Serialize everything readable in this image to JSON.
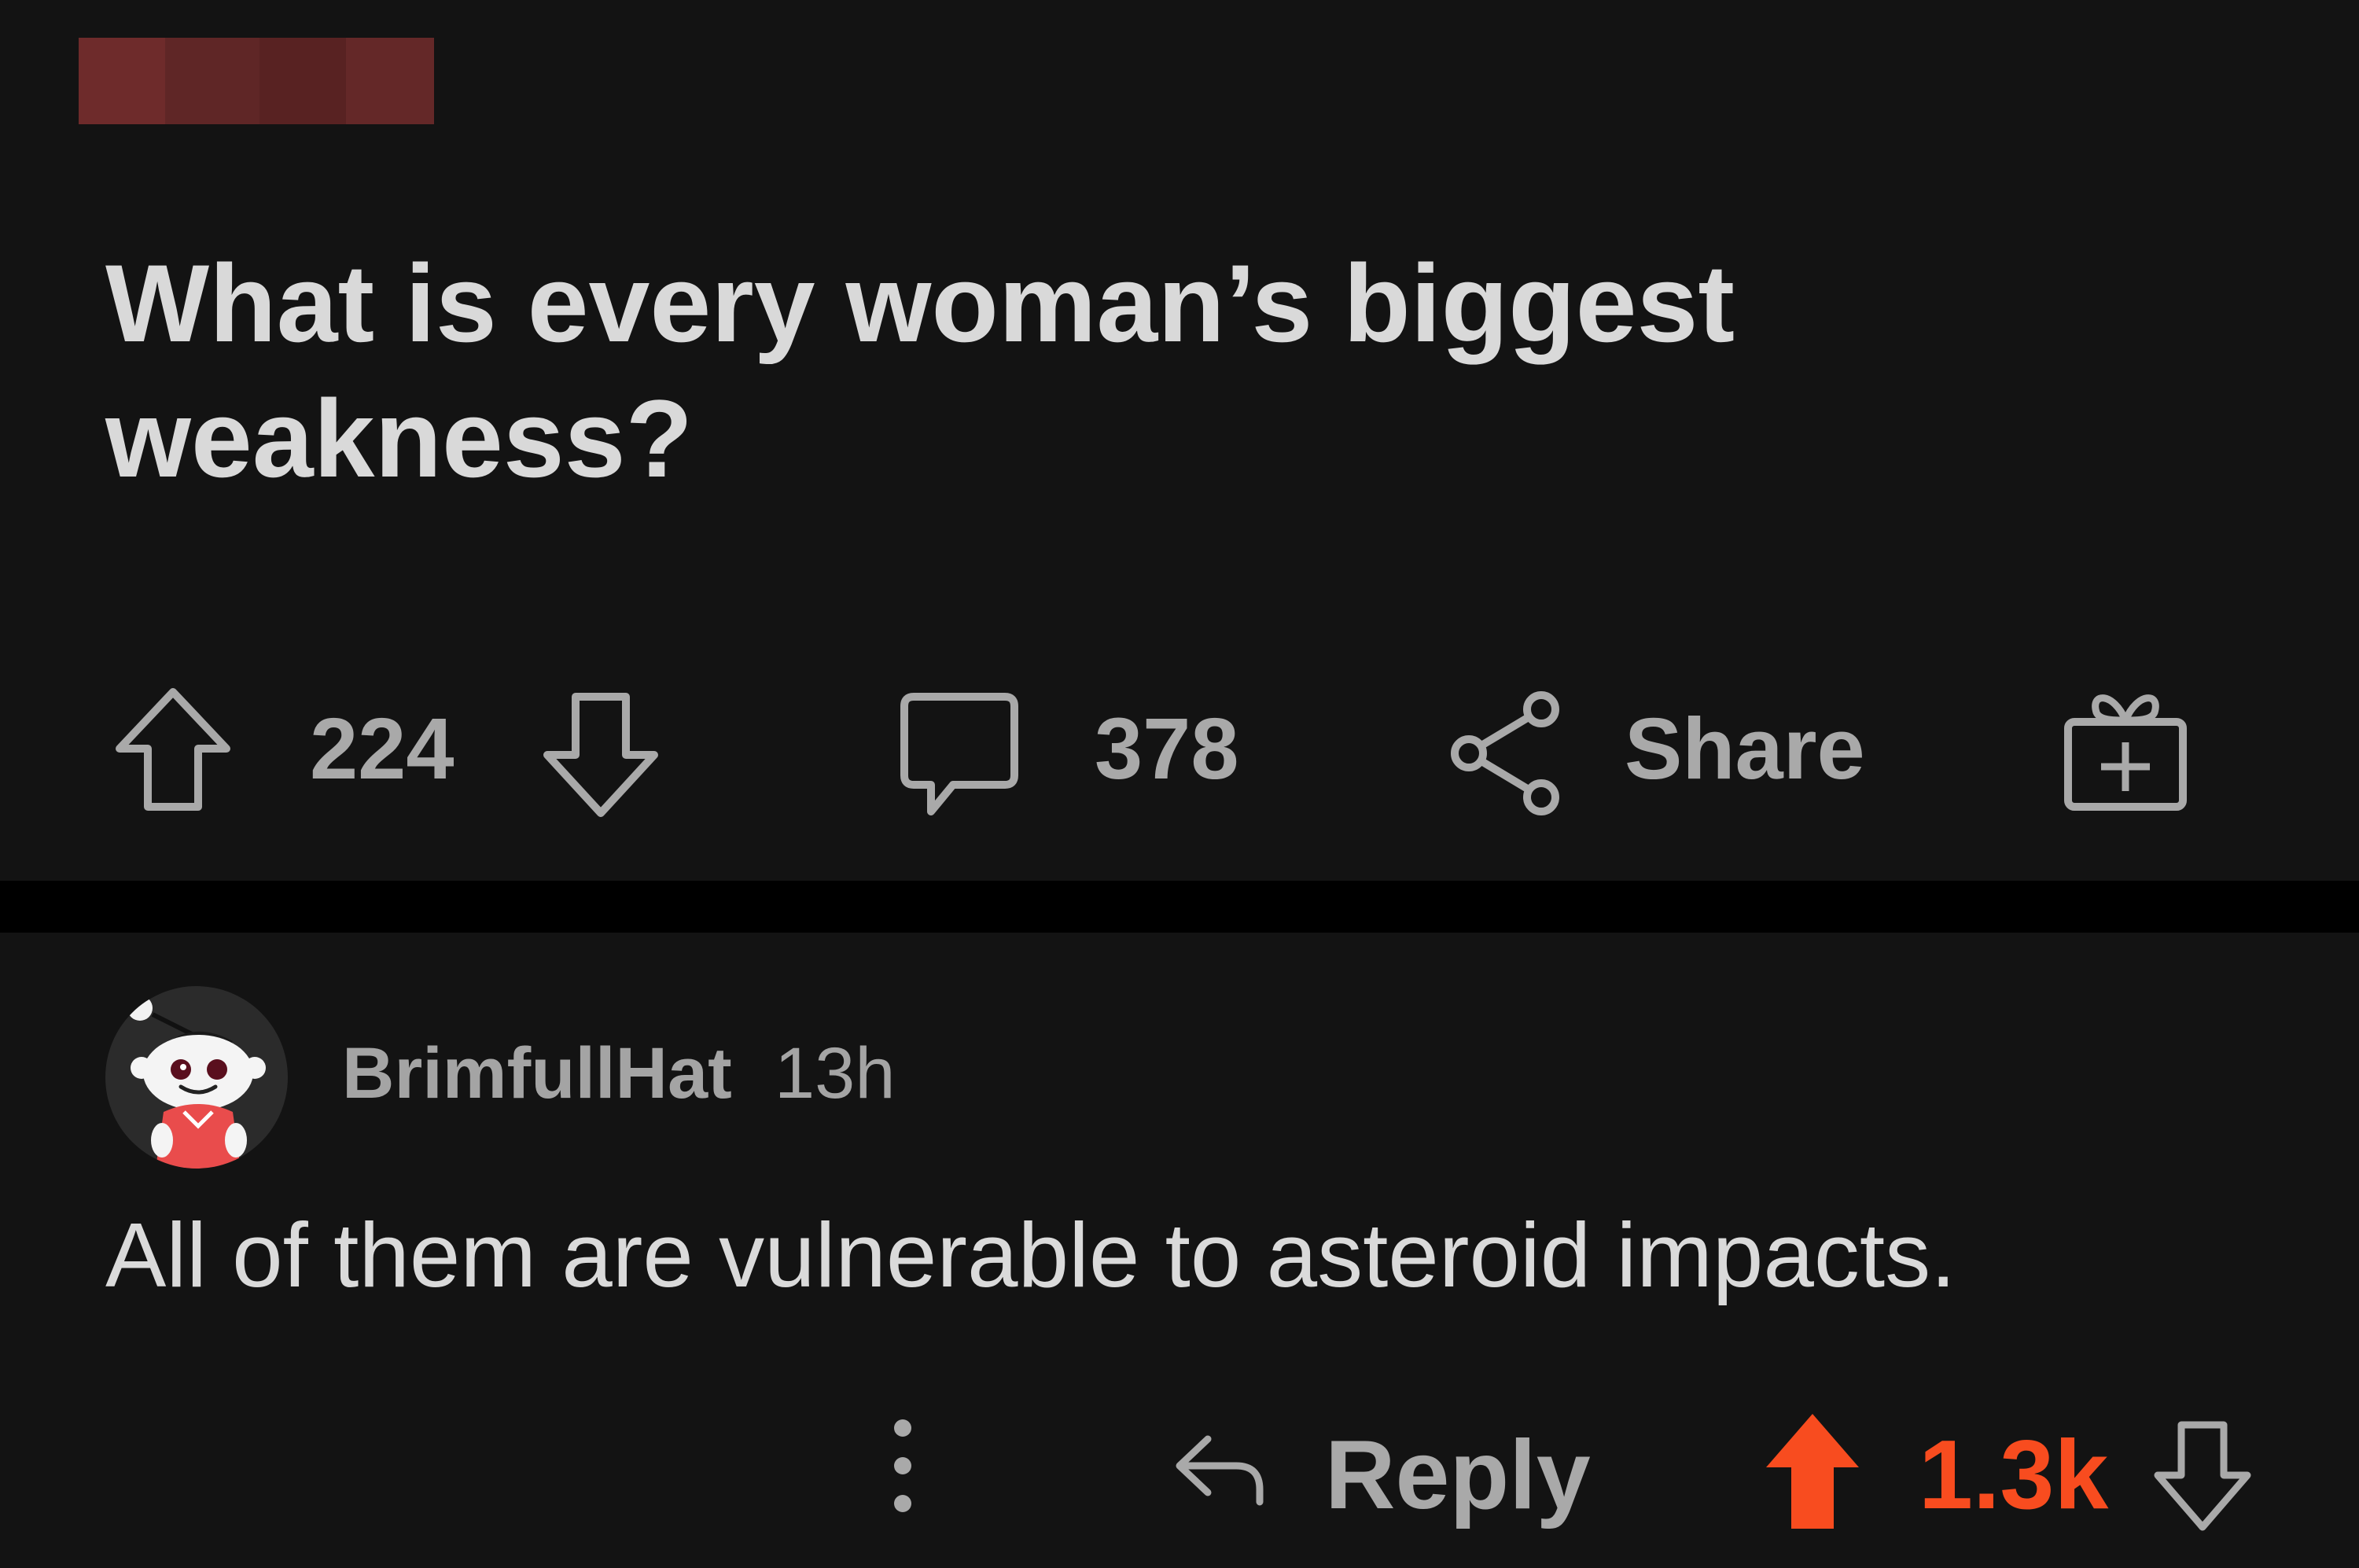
{
  "post": {
    "title": "What is every woman’s biggest weakness?",
    "upvotes": "224",
    "comments": "378",
    "share_label": "Share"
  },
  "comment": {
    "username": "BrimfullHat",
    "timestamp": "13h",
    "body": "All of them are vulnerable to asteroid impacts.",
    "reply_label": "Reply",
    "score": "1.3k",
    "upvoted": true
  },
  "colors": {
    "background": "#131313",
    "divider": "#000000",
    "upvote_active": "#f84c1f",
    "muted_text": "#a9a9a9",
    "redacted_block": "#6b2a2a"
  },
  "icons": {
    "post_upvote": "arrow-up-outline-icon",
    "post_downvote": "arrow-down-outline-icon",
    "comments": "speech-bubble-icon",
    "share": "share-nodes-icon",
    "award": "gift-box-icon",
    "more": "vertical-ellipsis-icon",
    "reply": "reply-arrow-icon",
    "comment_upvote": "arrow-up-filled-icon",
    "comment_downvote": "arrow-down-outline-icon"
  }
}
